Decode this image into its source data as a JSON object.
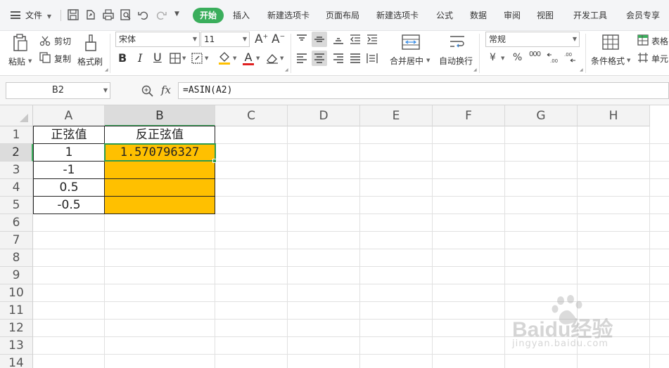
{
  "menubar": {
    "file_label": "文件",
    "tabs": [
      {
        "label": "开始",
        "active": true
      },
      {
        "label": "插入"
      },
      {
        "label": "新建选项卡"
      },
      {
        "label": "页面布局"
      },
      {
        "label": "新建选项卡"
      },
      {
        "label": "公式"
      },
      {
        "label": "数据"
      },
      {
        "label": "审阅"
      },
      {
        "label": "视图"
      },
      {
        "label": "开发工具"
      },
      {
        "label": "会员专享"
      }
    ]
  },
  "ribbon": {
    "paste_label": "粘贴",
    "cut_label": "剪切",
    "copy_label": "复制",
    "format_painter_label": "格式刷",
    "font_name": "宋体",
    "font_size": "11",
    "merge_label": "合并居中",
    "wrap_label": "自动换行",
    "number_format": "常规",
    "currency_symbol": "¥",
    "percent_symbol": "%",
    "thousands_symbol": "000",
    "cond_format_label": "条件格式",
    "table_style_label": "表格",
    "cell_label": "单元",
    "bold": "B",
    "italic": "I",
    "underline": "U",
    "font_color_letter": "A",
    "accent": "#3aae5c"
  },
  "formulabar": {
    "name_box": "B2",
    "fx": "fx",
    "formula": "=ASIN(A2)"
  },
  "sheet": {
    "columns": [
      "A",
      "B",
      "C",
      "D",
      "E",
      "F",
      "G",
      "H"
    ],
    "rows": [
      "1",
      "2",
      "3",
      "4",
      "5",
      "6",
      "7",
      "8",
      "9",
      "10",
      "11",
      "12",
      "13",
      "14"
    ],
    "cells": {
      "A1": "正弦值",
      "B1": "反正弦值",
      "A2": "1",
      "B2": "1.570796327",
      "A3": "-1",
      "A4": "0.5",
      "A5": "-0.5"
    },
    "fill_color": "#ffc000",
    "selection_color": "#2e9a4e"
  },
  "watermark": {
    "brand": "Baidu经验",
    "url": "jingyan.baidu.com"
  }
}
